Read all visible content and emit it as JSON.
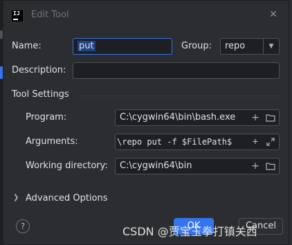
{
  "window": {
    "title": "Edit Tool",
    "app_icon_text": "IJ"
  },
  "form": {
    "name_label": "Name:",
    "name_value": "put",
    "group_label": "Group:",
    "group_value": "repo",
    "description_label": "Description:",
    "description_value": ""
  },
  "tool_settings": {
    "title": "Tool Settings",
    "program_label": "Program:",
    "program_value": "C:\\cygwin64\\bin\\bash.exe",
    "arguments_label": "Arguments:",
    "arguments_value": "\\repo put -f $FilePath$",
    "working_dir_label": "Working directory:",
    "working_dir_value": "C:\\cygwin64\\bin"
  },
  "advanced": {
    "label": "Advanced Options"
  },
  "buttons": {
    "help": "?",
    "ok": "OK",
    "cancel": "Cancel"
  },
  "watermark": "CSDN @贾宝玉拳打镇关西",
  "icons": {
    "add": "plus-icon",
    "folder": "folder-icon",
    "expand": "expand-icon",
    "close": "close-icon",
    "dropdown": "chevron-down-icon",
    "chevron_right": "chevron-right-icon"
  },
  "colors": {
    "accent": "#3574f0",
    "background": "#2b2d30",
    "field_bg": "#1e1f22",
    "selection": "#214283"
  }
}
